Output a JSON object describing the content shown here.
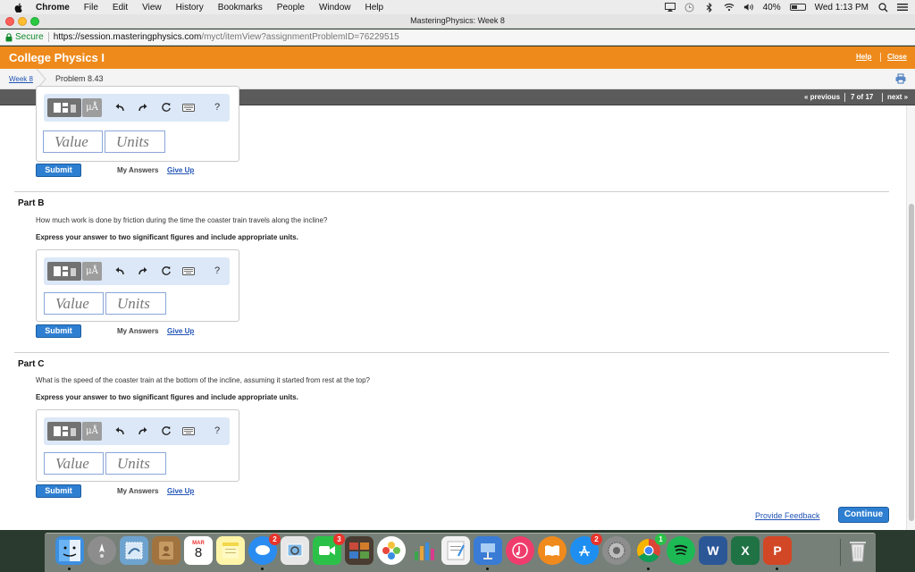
{
  "menubar": {
    "app_name": "Chrome",
    "items": [
      "File",
      "Edit",
      "View",
      "History",
      "Bookmarks",
      "People",
      "Window",
      "Help"
    ],
    "battery": "40%",
    "clock": "Wed 1:13 PM"
  },
  "window": {
    "title": "MasteringPhysics: Week 8"
  },
  "address": {
    "secure_label": "Secure",
    "url_host": "https://session.masteringphysics.com",
    "url_path": "/myct/itemView?assignmentProblemID=76229515"
  },
  "header": {
    "course": "College Physics I",
    "help": "Help",
    "close": "Close"
  },
  "breadcrumb": {
    "week": "Week 8",
    "problem": "Problem 8.43"
  },
  "nav": {
    "previous": "« previous",
    "count": "7 of 17",
    "next": "next »"
  },
  "answer_ui": {
    "units_button": "μÅ",
    "help_button": "?",
    "value_placeholder": "Value",
    "units_placeholder": "Units",
    "submit": "Submit",
    "my_answers": "My Answers",
    "give_up": "Give Up"
  },
  "parts": [
    {
      "title": "Part B",
      "question": "How much work is done by friction during the time the coaster train travels along the incline?",
      "instruction": "Express your answer to two significant figures and include appropriate units."
    },
    {
      "title": "Part C",
      "question": "What is the speed of the coaster train at the bottom of the incline, assuming it started from rest at the top?",
      "instruction": "Express your answer to two significant figures and include appropriate units."
    }
  ],
  "footer": {
    "feedback": "Provide Feedback",
    "continue": "Continue"
  },
  "dock": {
    "calendar_month": "MAR",
    "calendar_day": "8",
    "messages_badge": "2",
    "facetime_badge": "3",
    "appstore_badge": "2",
    "chrome_badge": "1",
    "word_letter": "W",
    "excel_letter": "X",
    "powerpoint_letter": "P"
  }
}
